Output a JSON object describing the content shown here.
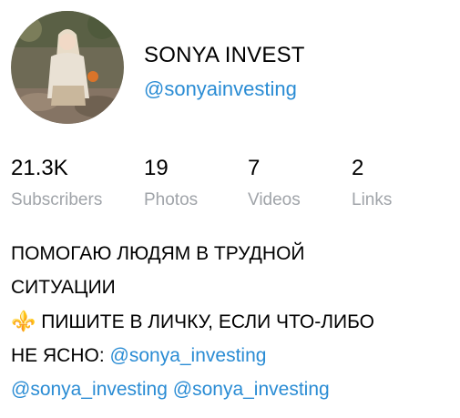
{
  "profile": {
    "name": "SONYA INVEST",
    "handle": "@sonyainvesting",
    "avatar_icon": "profile-photo"
  },
  "stats": [
    {
      "value": "21.3K",
      "label": "Subscribers"
    },
    {
      "value": "19",
      "label": "Photos"
    },
    {
      "value": "7",
      "label": "Videos"
    },
    {
      "value": "2",
      "label": "Links"
    }
  ],
  "bio": {
    "line1": "ПОМОГАЮ ЛЮДЯМ В ТРУДНОЙ",
    "line2": "СИТУАЦИИ",
    "emoji": "⚜️",
    "line3": " ПИШИТЕ В ЛИЧКУ, ЕСЛИ ЧТО-ЛИБО",
    "line4": "НЕ ЯСНО: ",
    "links": [
      "@sonya_investing",
      "@sonya_investing",
      "@sonya_investing"
    ]
  },
  "colors": {
    "link": "#2a8cd4",
    "muted": "#a0a4a9"
  }
}
